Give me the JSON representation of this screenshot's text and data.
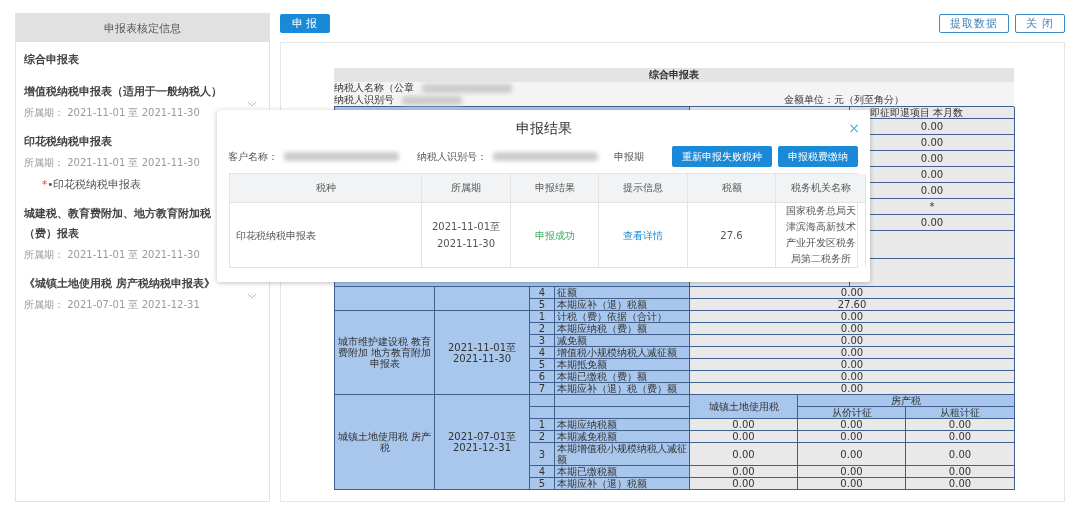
{
  "sidebar": {
    "title": "申报表核定信息",
    "items": [
      {
        "title": "综合申报表"
      },
      {
        "title": "增值税纳税申报表（适用于一般纳税人）",
        "period_label": "所属期：",
        "period": "2021-11-01 至 2021-11-30",
        "expanded": false
      },
      {
        "title": "印花税纳税申报表",
        "period_label": "所属期：",
        "period": "2021-11-01 至 2021-11-30",
        "expanded": true,
        "children": [
          {
            "required_mark": "*",
            "label": "•印花税纳税申报表"
          }
        ]
      },
      {
        "title": "城建税、教育费附加、地方教育附加税（费）报表",
        "period_label": "所属期：",
        "period": "2021-11-01 至 2021-11-30"
      },
      {
        "title": "《城镇土地使用税 房产税纳税申报表》",
        "period_label": "所属期：",
        "period": "2021-07-01 至 2021-12-31",
        "expanded": false
      }
    ]
  },
  "toolbar": {
    "primary": "申 报",
    "actions": [
      "提取数据",
      "关 闭"
    ]
  },
  "report": {
    "title": "综合申报表",
    "taxpayer_name_label": "纳税人名称（公章",
    "taxpayer_id_label": "纳税人识别号",
    "unit": "金额单位：元（列至角分）",
    "upper_header": "即征即退项目 本月数",
    "upper_values": [
      "0.00",
      "0.00",
      "0.00",
      "0.00",
      "0.00",
      "*",
      "0.00"
    ],
    "stamp_rows": [
      {
        "no": "4",
        "item": "征额",
        "value": "0.00"
      },
      {
        "no": "5",
        "item": "本期应补（退）税额",
        "value": "27.60"
      }
    ],
    "urban": {
      "name": "城市维护建设税 教育费附加 地方教育附加申报表",
      "period": "2021-11-01至 2021-11-30",
      "rows": [
        {
          "no": "1",
          "item": "计税（费）依据（合计）",
          "value": "0.00"
        },
        {
          "no": "2",
          "item": "本期应纳税（费）额",
          "value": "0.00"
        },
        {
          "no": "3",
          "item": "减免额",
          "value": "0.00"
        },
        {
          "no": "4",
          "item": "增值税小规模纳税人减征额",
          "value": "0.00"
        },
        {
          "no": "5",
          "item": "本期抵免额",
          "value": "0.00"
        },
        {
          "no": "6",
          "item": "本期已缴税（费）额",
          "value": "0.00"
        },
        {
          "no": "7",
          "item": "本期应补（退）税（费）额",
          "value": "0.00"
        }
      ]
    },
    "land": {
      "name": "城镇土地使用税 房产税",
      "period": "2021-07-01至 2021-12-31",
      "col_land": "城镇土地使用税",
      "col_house": "房产税",
      "col_house_value": "从价计征",
      "col_house_rent": "从租计征",
      "rows": [
        {
          "no": "1",
          "item": "本期应纳税额",
          "values": [
            "0.00",
            "0.00",
            "0.00"
          ]
        },
        {
          "no": "2",
          "item": "本期减免税额",
          "values": [
            "0.00",
            "0.00",
            "0.00"
          ]
        },
        {
          "no": "3",
          "item": "本期增值税小规模纳税人减征额",
          "values": [
            "0.00",
            "0.00",
            "0.00"
          ]
        },
        {
          "no": "4",
          "item": "本期已缴税额",
          "values": [
            "0.00",
            "0.00",
            "0.00"
          ]
        },
        {
          "no": "5",
          "item": "本期应补（退）税额",
          "values": [
            "0.00",
            "0.00",
            "0.00"
          ]
        }
      ]
    }
  },
  "dialog": {
    "title": "申报结果",
    "close": "×",
    "customer_label": "客户名称：",
    "taxpayer_id_label": "纳税人识别号：",
    "period_label": "申报期",
    "buttons": [
      "重新申报失败税种",
      "申报税费缴纳"
    ],
    "columns": [
      "税种",
      "所属期",
      "申报结果",
      "提示信息",
      "税额",
      "税务机关名称"
    ],
    "rows": [
      {
        "tax": "印花税纳税申报表",
        "period": "2021-11-01至 2021-11-30",
        "result": "申报成功",
        "success": true,
        "info": "查看详情",
        "amount": "27.6",
        "office": "国家税务总局天津滨海高新技术产业开发区税务局第二税务所"
      }
    ]
  }
}
